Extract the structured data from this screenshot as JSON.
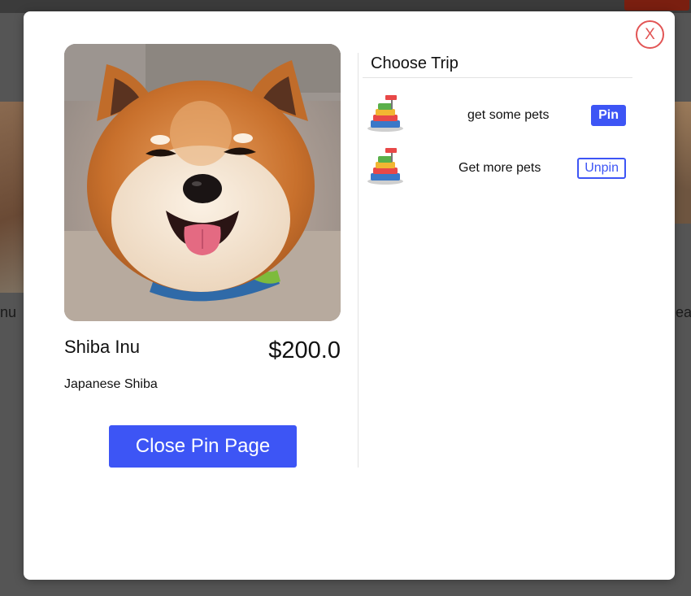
{
  "background": {
    "partial_left_text": "nu",
    "partial_right_text": "eat"
  },
  "modal": {
    "close_label": "X",
    "pet": {
      "name": "Shiba Inu",
      "price": "$200.0",
      "breed": "Japanese Shiba",
      "photo_icon": "dog-photo"
    },
    "close_pin_button": "Close Pin Page",
    "trips": {
      "title": "Choose Trip",
      "items": [
        {
          "name": "get some pets",
          "action": "Pin",
          "icon": "pet-shop-stack-icon"
        },
        {
          "name": "Get more pets",
          "action": "Unpin",
          "icon": "pet-shop-stack-icon"
        }
      ]
    }
  },
  "colors": {
    "accent": "#3d55f5",
    "close": "#e25555",
    "overlay": "#4a4a4a"
  }
}
